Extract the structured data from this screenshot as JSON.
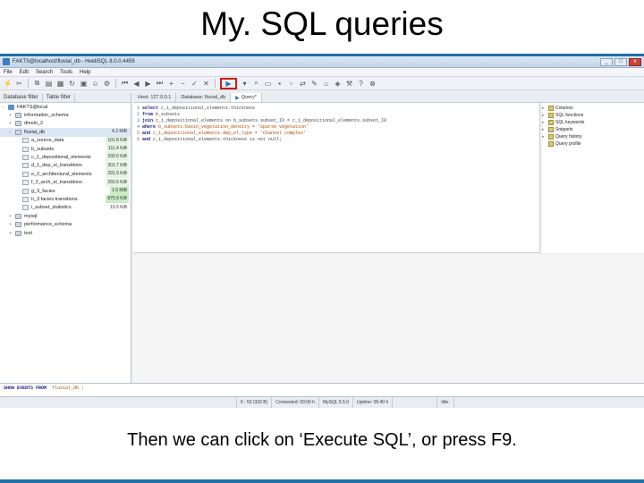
{
  "slide": {
    "title": "My. SQL queries",
    "caption": "Then we can click on ‘Execute SQL’, or press F9."
  },
  "app": {
    "window_title": "FAKTS@localhost\\fluvial_db - HeidiSQL 8.0.0.4459",
    "controls": {
      "min": "_",
      "max": "□",
      "close": "x"
    },
    "menu": [
      "File",
      "Edit",
      "Search",
      "Tools",
      "Help"
    ],
    "accent": "#1f6fa8",
    "execute_highlight": "#d11a1a"
  },
  "left_panel": {
    "tabs": [
      "Database filter",
      "Table filter"
    ],
    "tree": [
      {
        "label": "FAKTS@local",
        "level": 0,
        "exp": "−",
        "icon": "host-icon",
        "size": "",
        "size_style": ""
      },
      {
        "label": "information_schema",
        "level": 1,
        "exp": "+",
        "icon": "database-icon",
        "size": "",
        "size_style": ""
      },
      {
        "label": "dmelo_2",
        "level": 1,
        "exp": "+",
        "icon": "database-icon",
        "size": "",
        "size_style": ""
      },
      {
        "label": "fluvial_db",
        "level": 1,
        "exp": "−",
        "icon": "database-icon",
        "size": "4.2 MiB",
        "size_style": "none",
        "selected": true
      },
      {
        "label": "a_source_data",
        "level": 2,
        "exp": "",
        "icon": "table-icon",
        "size": "101.8 KiB",
        "size_style": "lgreen"
      },
      {
        "label": "b_subsets",
        "level": 2,
        "exp": "",
        "icon": "table-icon",
        "size": "111.4 KiB",
        "size_style": "lgreen"
      },
      {
        "label": "c_1_depositional_elements",
        "level": 2,
        "exp": "",
        "icon": "table-icon",
        "size": "330.0 KiB",
        "size_style": "lgreen"
      },
      {
        "label": "d_1_dep_el_transitions",
        "level": 2,
        "exp": "",
        "icon": "table-icon",
        "size": "301.7 KiB",
        "size_style": "lgreen"
      },
      {
        "label": "e_2_architectural_elements",
        "level": 2,
        "exp": "",
        "icon": "table-icon",
        "size": "291.9 KiB",
        "size_style": "lgreen"
      },
      {
        "label": "f_2_arch_el_transitions",
        "level": 2,
        "exp": "",
        "icon": "table-icon",
        "size": "293.5 KiB",
        "size_style": "lgreen"
      },
      {
        "label": "g_3_facies",
        "level": 2,
        "exp": "",
        "icon": "table-icon",
        "size": "1.6 MiB",
        "size_style": "green"
      },
      {
        "label": "h_3 facies transitions",
        "level": 2,
        "exp": "",
        "icon": "table-icon",
        "size": "875.9 KiB",
        "size_style": "green"
      },
      {
        "label": "i_subset_statistics",
        "level": 2,
        "exp": "",
        "icon": "table-icon",
        "size": "15.5 KiB",
        "size_style": "none"
      },
      {
        "label": "mysql",
        "level": 1,
        "exp": "+",
        "icon": "database-icon",
        "size": "",
        "size_style": ""
      },
      {
        "label": "performance_schema",
        "level": 1,
        "exp": "+",
        "icon": "database-icon",
        "size": "",
        "size_style": ""
      },
      {
        "label": "test",
        "level": 1,
        "exp": "+",
        "icon": "database-icon",
        "size": "",
        "size_style": ""
      }
    ]
  },
  "right_tabs": {
    "host": "Host: 127.0.0.1",
    "database": "Database: fluvial_db",
    "query": "Query*"
  },
  "editor": {
    "lines": [
      {
        "n": "1",
        "k": "select ",
        "r": "c_1_depositional_elements.thickness",
        "rs": "fld"
      },
      {
        "n": "2",
        "k": "from ",
        "r": "b_subsets",
        "rs": "fld"
      },
      {
        "n": "3",
        "k": "join ",
        "r": "c_1_depositional_elements on b_subsets.subset_ID = c_1_depositional_elements.subset_ID",
        "rs": "fld"
      },
      {
        "n": "4",
        "k": "where ",
        "r": "b_subsets.basin_vegetation_density = 'Sparse vegetation'",
        "rs": "str"
      },
      {
        "n": "5",
        "k": "and ",
        "r": "c_1_depositional_elements.dep_el_type = 'Channel complex'",
        "rs": "str"
      },
      {
        "n": "6",
        "k": "and ",
        "r": "c_1_depositional_elements.thickness is not null;",
        "rs": "fld"
      }
    ]
  },
  "helpers": [
    {
      "label": "Columns",
      "exp": "▸"
    },
    {
      "label": "SQL functions",
      "exp": "▸"
    },
    {
      "label": "SQL keywords",
      "exp": "▸"
    },
    {
      "label": "Snippets",
      "exp": "▸"
    },
    {
      "label": "Query history",
      "exp": "▸"
    },
    {
      "label": "Query profile",
      "exp": ""
    }
  ],
  "log": {
    "line": "SHOW EVENTS FROM",
    "db": "`fluvial_db`;"
  },
  "status": {
    "position": "6 : 53 (332 B)",
    "connected": "Connected: 00:00 h",
    "server": "MySQL 5.5.0",
    "uptime": "Uptime: 05:40 h",
    "state": "Idle."
  }
}
